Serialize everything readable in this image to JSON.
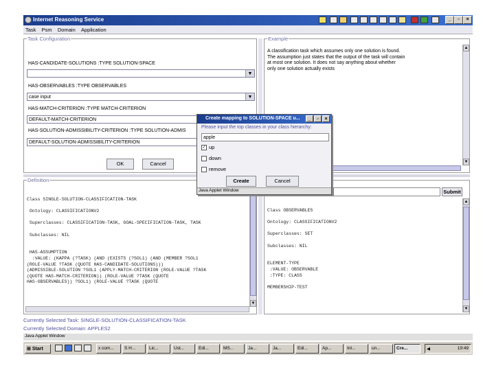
{
  "window": {
    "title": "Internet Reasoning Service"
  },
  "menu": [
    "Task",
    "Psm",
    "Domain",
    "Application"
  ],
  "task_config": {
    "legend": "Task Configuration",
    "rows": [
      {
        "label": "HAS-CANDIDATE-SOLUTIONS  :TYPE  SOLUTION-SPACE",
        "value": ""
      },
      {
        "label": "HAS-OBSERVABLES  :TYPE  OBSERVABLES",
        "value": "case input"
      },
      {
        "label": "HAS-MATCH-CRITERION  :TYPE  MATCH-CRITERION",
        "value": "DEFAULT-MATCH-CRITERION"
      },
      {
        "label": "HAS-SOLUTION-ADMISSIBILITY-CRITERION  :TYPE  SOLUTION-ADMIS",
        "value": "DEFAULT-SOLUTION-ADMISSIBILITY-CRITERION"
      }
    ],
    "ok": "OK",
    "cancel": "Cancel"
  },
  "example": {
    "legend": "Example",
    "lines": [
      "A classification task which assumes only one solution is found.",
      "The assumption just states that the output of the task will contain",
      "at most one solution. It does not say anything about whether",
      "only one solution actually exists"
    ]
  },
  "definition": {
    "legend": "Definition",
    "text": "Class SINGLE-SOLUTION-CLASSIFICATION-TASK\n\n Ontology: CLASSIFICATIONV2\n\n Superclasses: CLASSIFICATION-TASK, GOAL-SPECIFICATION-TASK, TASK\n\n Subclasses: NIL\n\n\n HAS-ASSUMPTION\n  :VALUE: (KAPPA (?TASK) (AND (EXISTS (?SOL1) (AND (MEMBER ?SOL1\n(ROLE-VALUE ?TASK (QUOTE HAS-CANDIDATE-SOLUTIONS)))\n(ADMISSIBLE-SOLUTION ?SOL1 (APPLY-MATCH-CRITERION (ROLE-VALUE ?TASK\n(QUOTE HAS-MATCH-CRITERION)) (ROLE-VALUE ?TASK (QUOTE\nHAS-OBSERVABLES)) ?SOL1) (ROLE-VALUE ?TASK (QUOTE"
  },
  "right_def": {
    "submit": "Submit",
    "text": "Class OBSERVABLES\n\nOntology: CLASSIFICATIONV2\n\nSuperclasses: SET\n\nSubclasses: NIL\n\n\nELEMENT-TYPE\n :VALUE: OBSERVABLE\n :TYPE: CLASS\n\nMEMBERSHIP-TEST"
  },
  "dialog": {
    "title": "Create mapping to  SOLUTION-SPACE u...",
    "prompt": "Please input the top classes in your class hierarchy:",
    "input_value": "apple",
    "options": [
      {
        "label": "up",
        "checked": true
      },
      {
        "label": "down",
        "checked": false
      },
      {
        "label": "remove",
        "checked": false
      }
    ],
    "create": "Create",
    "cancel": "Cancel",
    "footer": "Java Applet Window"
  },
  "status": {
    "task": "Currently Selected Task: SINGLE-SOLUTION-CLASSIFICATION-TASK",
    "domain": "Currently Selected Domain: APPLES2",
    "applet": "Java Applet Window"
  },
  "taskbar": {
    "start": "Start",
    "items": [
      "x com...",
      "S H...",
      "Lic...",
      "Ust...",
      "Edi...",
      "MS...",
      "Ja...",
      "Ja...",
      "Edi...",
      "Ap...",
      "Int...",
      "un...",
      "Cre..."
    ],
    "clock": "19:49"
  }
}
